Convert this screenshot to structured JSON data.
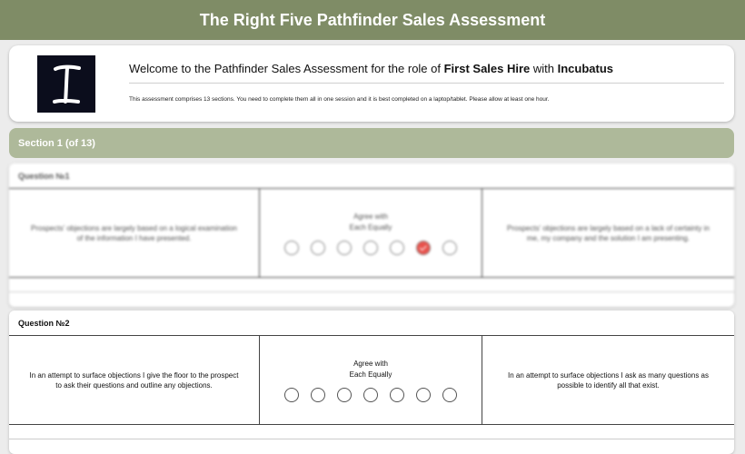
{
  "header": {
    "title": "The Right Five Pathfinder Sales Assessment"
  },
  "welcome": {
    "prefix": "Welcome to the Pathfinder Sales Assessment for the role of ",
    "role": "First Sales Hire",
    "connector": " with ",
    "company": "Incubatus",
    "note": "This assessment comprises 13 sections. You need to complete them all in one session and it is best completed on a laptop/tablet. Please allow at least one hour.",
    "logo_letter": "I"
  },
  "section": {
    "label": "Section 1 (of 13)"
  },
  "questions": [
    {
      "title": "Question №1",
      "left": "Prospects' objections are largely based on a logical examination of the information I have presented.",
      "middle": "Agree with\nEach Equally",
      "right": "Prospects' objections are largely based on a lack of certainty in me, my company and the solution I am presenting.",
      "options": 7,
      "selected": 6
    },
    {
      "title": "Question №2",
      "left": "In an attempt to surface objections I give the floor to the prospect to ask their questions and outline any objections.",
      "middle": "Agree with\nEach Equally",
      "right": "In an attempt to surface objections I ask as many questions as possible to identify all that exist.",
      "options": 7,
      "selected": null
    }
  ],
  "colors": {
    "topbar": "#7f8c66",
    "section": "#aeb99a",
    "selected": "#e8534d"
  }
}
